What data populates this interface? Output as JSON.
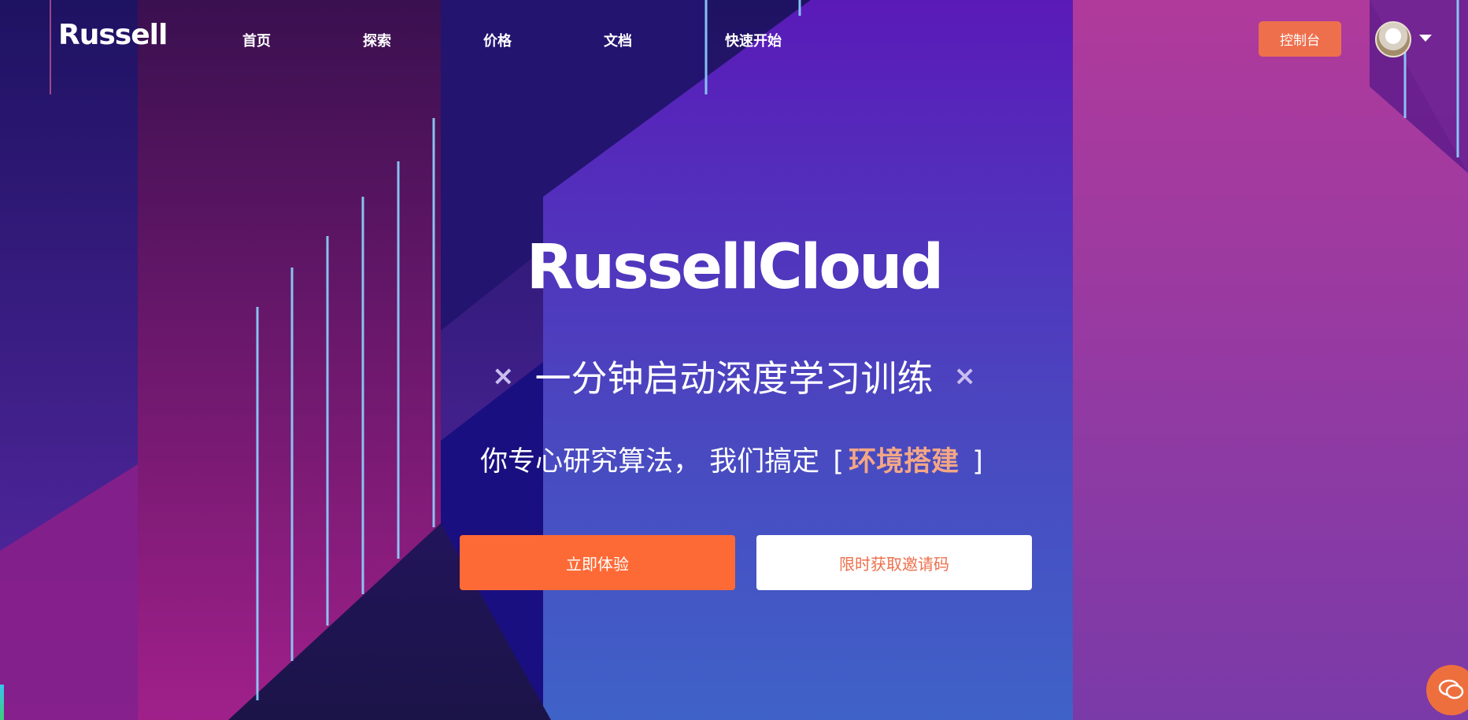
{
  "header": {
    "logo": "Russell",
    "nav": [
      "首页",
      "探索",
      "价格",
      "文档",
      "快速开始"
    ],
    "console_button": "控制台"
  },
  "hero": {
    "title": "RussellCloud",
    "tagline": "一分钟启动深度学习训练",
    "tagline_mark": "×",
    "subline_prefix": "你专心研究算法， 我们搞定",
    "subline_bracket_open": "[",
    "subline_highlight": "环境搭建",
    "subline_bracket_close": "]",
    "primary_button": "立即体验",
    "secondary_button": "限时获取邀请码"
  },
  "colors": {
    "accent": "#ee6f4c",
    "primary_button": "#fe6a36",
    "highlight": "#f4a785"
  },
  "icons": {
    "avatar": "user-avatar",
    "caret": "caret-down-icon",
    "chat": "chat-bubble-icon",
    "close_mark": "x-mark-icon"
  }
}
